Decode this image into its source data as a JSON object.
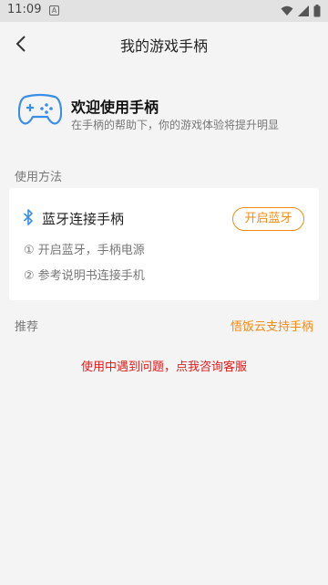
{
  "status_bar": {
    "time": "11:09",
    "app_icon_letter": "A",
    "icons": [
      "wifi-icon",
      "signal-icon",
      "battery-icon"
    ]
  },
  "app_bar": {
    "title": "我的游戏手柄",
    "back_icon": "back-arrow-icon"
  },
  "hero": {
    "title": "欢迎使用手柄",
    "subtitle": "在手柄的帮助下，你的游戏体验将提升明显",
    "icon": "gamepad-icon"
  },
  "usage": {
    "section_label": "使用方法",
    "card_title": "蓝牙连接手柄",
    "button_label": "开启蓝牙",
    "steps": [
      "① 开启蓝牙，手柄电源",
      "② 参考说明书连接手机"
    ],
    "icon": "bluetooth-icon"
  },
  "recommend": {
    "section_label": "推荐",
    "link_label": "悟饭云支持手柄"
  },
  "help_link": "使用中遇到问题，点我咨询客服",
  "colors": {
    "accent": "#f28c14",
    "alert": "#e11c1c",
    "icon_blue": "#3a8ee6",
    "background": "#f4f4f4"
  }
}
